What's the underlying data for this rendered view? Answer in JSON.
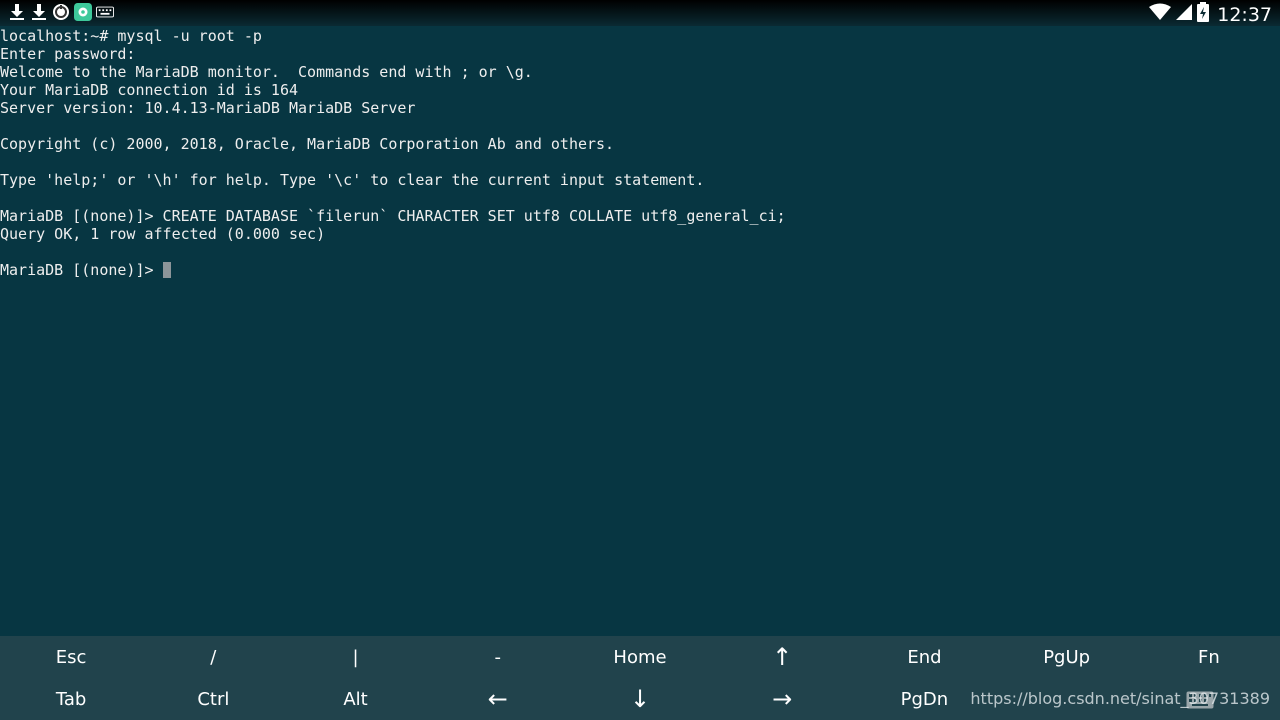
{
  "status_bar": {
    "left_icons": [
      "download-icon",
      "download-icon",
      "sync-icon",
      "app-store-icon",
      "keyboard-icon"
    ],
    "right_icons": [
      "wifi-icon",
      "cellular-signal-icon",
      "battery-icon"
    ],
    "time": "12:37"
  },
  "terminal": {
    "lines": [
      "localhost:~# mysql -u root -p",
      "Enter password:",
      "Welcome to the MariaDB monitor.  Commands end with ; or \\g.",
      "Your MariaDB connection id is 164",
      "Server version: 10.4.13-MariaDB MariaDB Server",
      "",
      "Copyright (c) 2000, 2018, Oracle, MariaDB Corporation Ab and others.",
      "",
      "Type 'help;' or '\\h' for help. Type '\\c' to clear the current input statement.",
      "",
      "MariaDB [(none)]> CREATE DATABASE `filerun` CHARACTER SET utf8 COLLATE utf8_general_ci;",
      "Query OK, 1 row affected (0.000 sec)",
      ""
    ],
    "prompt": "MariaDB [(none)]> "
  },
  "extra_keys": {
    "row1": [
      "Esc",
      "/",
      "|",
      "-",
      "Home",
      "↑",
      "End",
      "PgUp",
      "Fn"
    ],
    "row2": [
      "Tab",
      "Ctrl",
      "Alt",
      "←",
      "↓",
      "→",
      "PgDn"
    ]
  },
  "watermark": "https://blog.csdn.net/sinat_30731389",
  "colors": {
    "terminal_bg": "#073642",
    "extra_keys_bg": "#21434c",
    "text": "#eeeeee",
    "cursor": "#8c9599"
  }
}
